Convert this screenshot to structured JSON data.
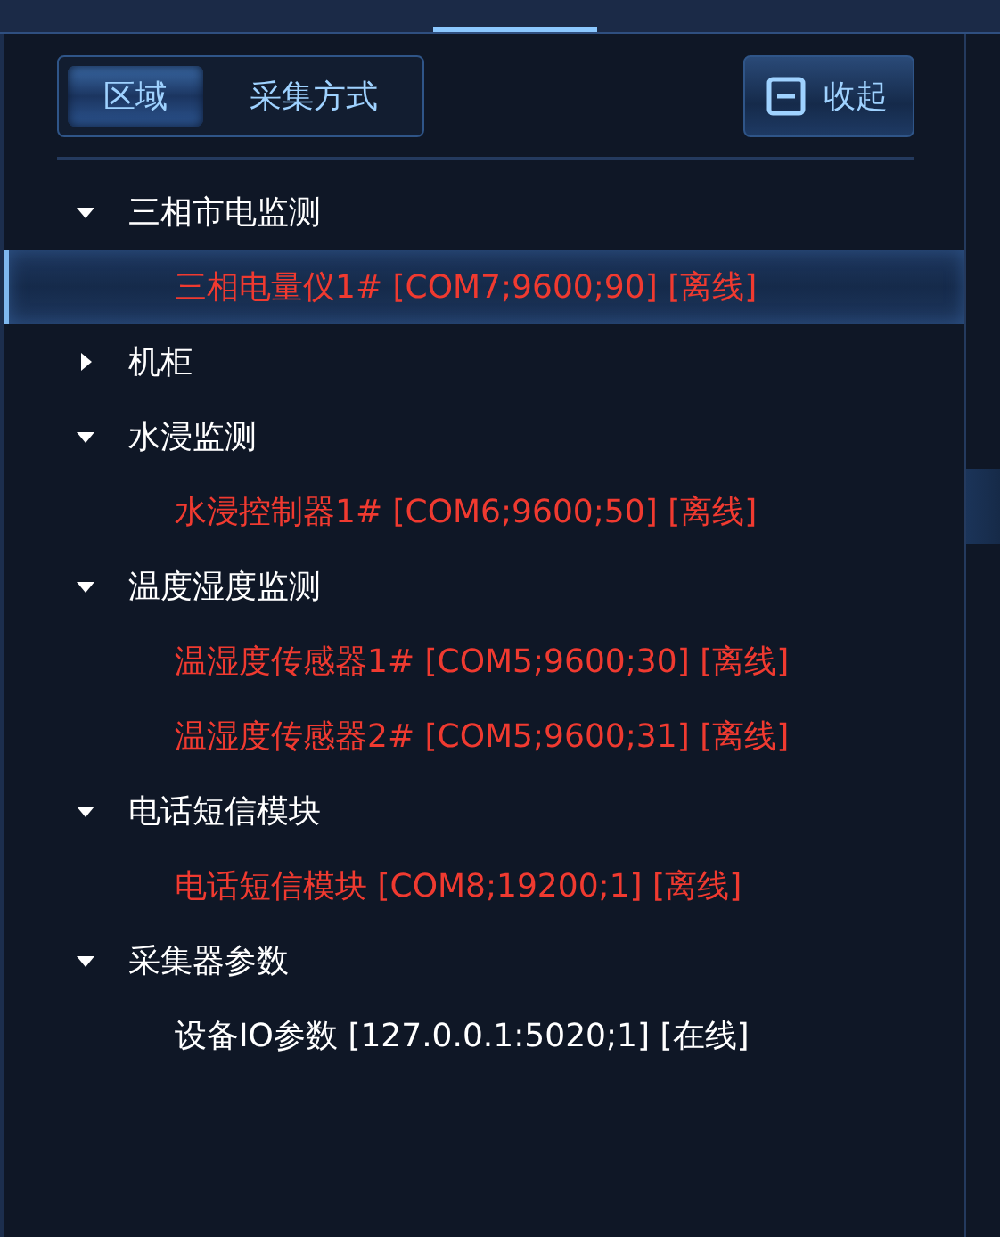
{
  "tabs": [
    {
      "label": "区域",
      "selected": true
    },
    {
      "label": "采集方式",
      "selected": false
    }
  ],
  "collapse_button": {
    "label": "收起"
  },
  "tree": [
    {
      "label": "三相市电监测",
      "expanded": true,
      "selected": false,
      "children": [
        {
          "label": "三相电量仪1# [COM7;9600;90] [离线]",
          "online": false,
          "selected": true
        }
      ]
    },
    {
      "label": "机柜",
      "expanded": false,
      "selected": false
    },
    {
      "label": "水浸监测",
      "expanded": true,
      "selected": false,
      "children": [
        {
          "label": "水浸控制器1# [COM6;9600;50] [离线]",
          "online": false,
          "selected": false
        }
      ]
    },
    {
      "label": "温度湿度监测",
      "expanded": true,
      "selected": false,
      "children": [
        {
          "label": "温湿度传感器1# [COM5;9600;30] [离线]",
          "online": false,
          "selected": false
        },
        {
          "label": "温湿度传感器2# [COM5;9600;31] [离线]",
          "online": false,
          "selected": false
        }
      ]
    },
    {
      "label": "电话短信模块",
      "expanded": true,
      "selected": false,
      "children": [
        {
          "label": "电话短信模块 [COM8;19200;1] [离线]",
          "online": false,
          "selected": false
        }
      ]
    },
    {
      "label": "采集器参数",
      "expanded": true,
      "selected": false,
      "children": [
        {
          "label": "设备IO参数 [127.0.0.1:5020;1] [在线]",
          "online": true,
          "selected": false
        }
      ]
    }
  ]
}
